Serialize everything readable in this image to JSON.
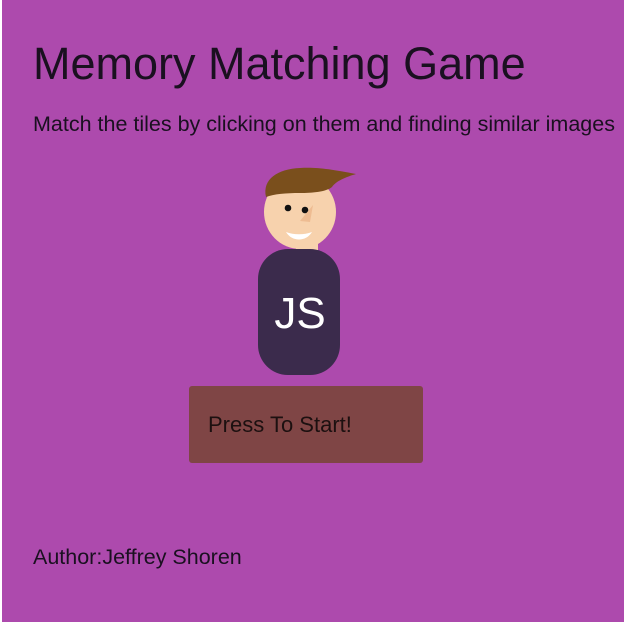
{
  "header": {
    "title": "Memory Matching Game",
    "instructions": "Match the tiles by clicking on them and finding similar images"
  },
  "avatar": {
    "badge_text": "JS",
    "skin_color": "#f7d2ad",
    "hair_color": "#7a4f1c",
    "body_color": "#3b2b4c"
  },
  "start_button": {
    "label": "Press To Start!"
  },
  "footer": {
    "author": "Author:Jeffrey Shoren"
  },
  "colors": {
    "background": "#ad4aad",
    "button": "#7f4545",
    "text": "#1a1020"
  }
}
